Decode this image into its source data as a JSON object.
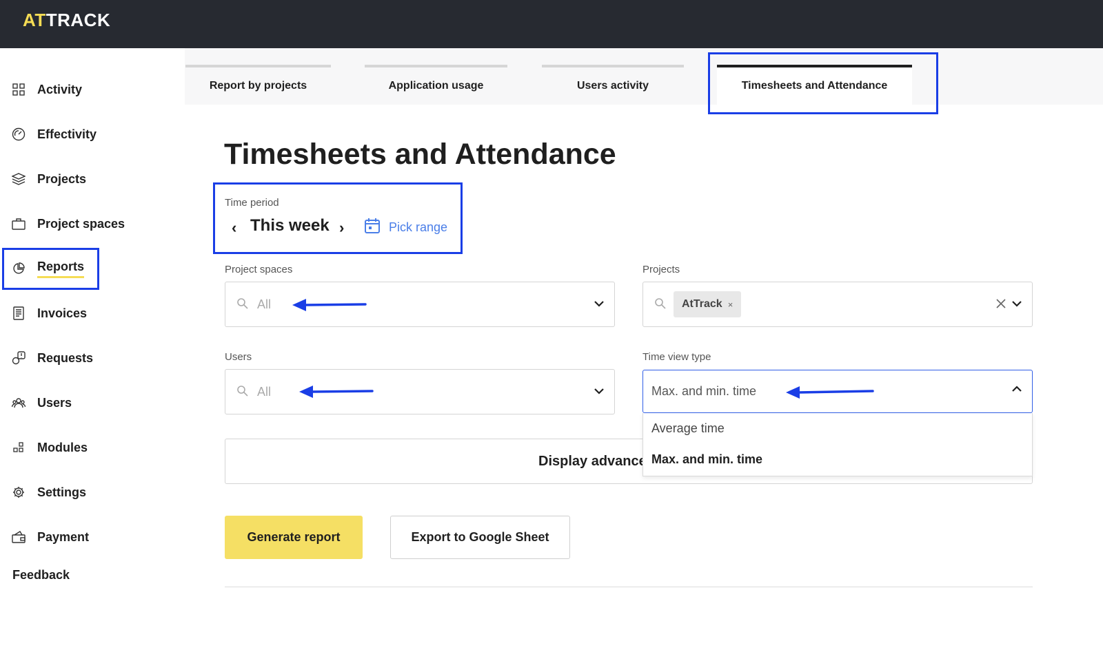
{
  "app": {
    "logo_accent": "AT",
    "logo_rest": "TRACK"
  },
  "sidebar": {
    "items": [
      {
        "label": "Activity",
        "icon": "grid-icon"
      },
      {
        "label": "Effectivity",
        "icon": "gauge-icon"
      },
      {
        "label": "Projects",
        "icon": "layers-icon"
      },
      {
        "label": "Project spaces",
        "icon": "briefcase-icon"
      },
      {
        "label": "Reports",
        "icon": "pie-chart-icon",
        "active": true
      },
      {
        "label": "Invoices",
        "icon": "receipt-icon"
      },
      {
        "label": "Requests",
        "icon": "request-icon"
      },
      {
        "label": "Users",
        "icon": "users-icon"
      },
      {
        "label": "Modules",
        "icon": "modules-icon"
      },
      {
        "label": "Settings",
        "icon": "gear-icon"
      },
      {
        "label": "Payment",
        "icon": "wallet-icon"
      }
    ],
    "feedback": "Feedback"
  },
  "tabs": [
    {
      "label": "Report by projects"
    },
    {
      "label": "Application usage"
    },
    {
      "label": "Users activity"
    },
    {
      "label": "Timesheets and Attendance",
      "active": true
    }
  ],
  "page": {
    "title": "Timesheets and Attendance",
    "time_period": {
      "label": "Time period",
      "value": "This week",
      "prev": "‹",
      "next": "›",
      "pick_range": "Pick range"
    },
    "project_spaces": {
      "label": "Project spaces",
      "placeholder": "All"
    },
    "projects": {
      "label": "Projects",
      "chip": "AtTrack",
      "chip_remove": "×"
    },
    "users": {
      "label": "Users",
      "placeholder": "All"
    },
    "time_view_type": {
      "label": "Time view type",
      "value": "Max. and min. time",
      "options": [
        "Average time",
        "Max. and min. time"
      ]
    },
    "advanced_button": "Display advanced",
    "generate_button": "Generate report",
    "export_button": "Export to Google Sheet"
  },
  "colors": {
    "topbar": "#272a31",
    "accent_yellow": "#f5dc55",
    "link_blue": "#4a7ee8",
    "annotation_blue": "#1a3ee6"
  }
}
